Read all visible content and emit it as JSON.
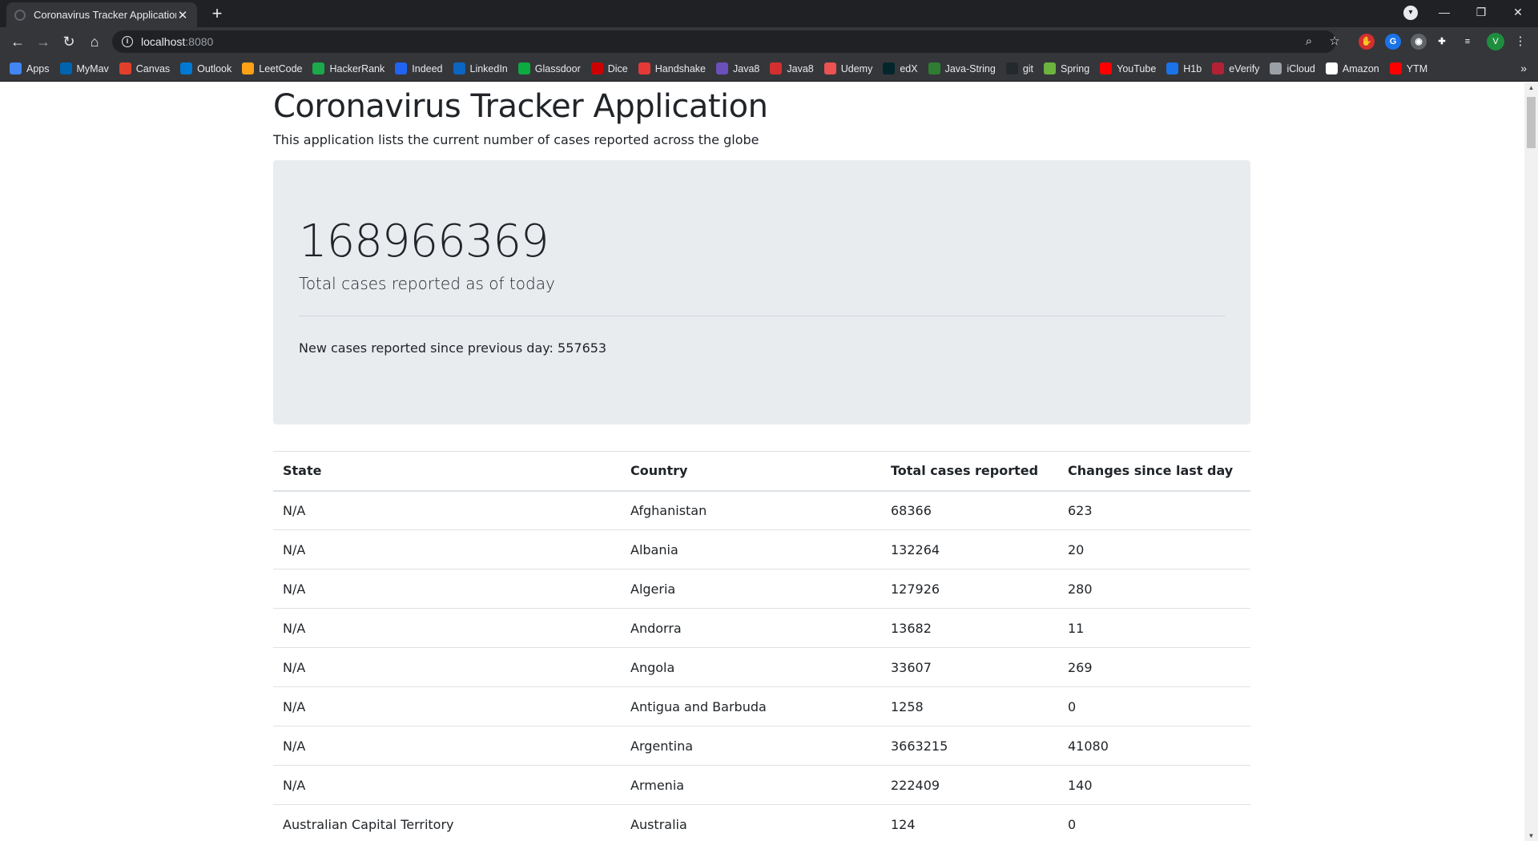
{
  "browser": {
    "tab_title": "Coronavirus Tracker Application",
    "url_host": "localhost",
    "url_port": ":8080",
    "profile_initial": "V",
    "bookmarks": [
      {
        "label": "Apps",
        "icon": "apps-grid-icon",
        "color": "#4285f4"
      },
      {
        "label": "MyMav",
        "icon": "mymav-icon",
        "color": "#0064b1"
      },
      {
        "label": "Canvas",
        "icon": "canvas-icon",
        "color": "#e13f2b"
      },
      {
        "label": "Outlook",
        "icon": "outlook-icon",
        "color": "#0078d4"
      },
      {
        "label": "LeetCode",
        "icon": "leetcode-icon",
        "color": "#ffa116"
      },
      {
        "label": "HackerRank",
        "icon": "hackerrank-icon",
        "color": "#1ba94c"
      },
      {
        "label": "Indeed",
        "icon": "indeed-icon",
        "color": "#2164f3"
      },
      {
        "label": "LinkedIn",
        "icon": "linkedin-icon",
        "color": "#0a66c2"
      },
      {
        "label": "Glassdoor",
        "icon": "glassdoor-icon",
        "color": "#0caa41"
      },
      {
        "label": "Dice",
        "icon": "dice-icon",
        "color": "#cc0000"
      },
      {
        "label": "Handshake",
        "icon": "handshake-icon",
        "color": "#e53935"
      },
      {
        "label": "Java8",
        "icon": "java8-icon",
        "color": "#6b4fbb"
      },
      {
        "label": "Java8",
        "icon": "java8-v-icon",
        "color": "#d32f2f"
      },
      {
        "label": "Udemy",
        "icon": "udemy-icon",
        "color": "#ec5252"
      },
      {
        "label": "edX",
        "icon": "edx-icon",
        "color": "#02262b"
      },
      {
        "label": "Java-String",
        "icon": "java-string-icon",
        "color": "#2e7d32"
      },
      {
        "label": "git",
        "icon": "github-icon",
        "color": "#24292e"
      },
      {
        "label": "Spring",
        "icon": "spring-icon",
        "color": "#6db33f"
      },
      {
        "label": "YouTube",
        "icon": "youtube-icon",
        "color": "#ff0000"
      },
      {
        "label": "H1b",
        "icon": "h1b-icon",
        "color": "#1a73e8"
      },
      {
        "label": "eVerify",
        "icon": "everify-icon",
        "color": "#b22234"
      },
      {
        "label": "iCloud",
        "icon": "apple-icon",
        "color": "#9aa0a6"
      },
      {
        "label": "Amazon",
        "icon": "amazon-icon",
        "color": "#ffffff"
      },
      {
        "label": "YTM",
        "icon": "youtube-music-icon",
        "color": "#ff0000"
      }
    ]
  },
  "page": {
    "title": "Coronavirus Tracker Application",
    "subtitle": "This application lists the current number of cases reported across the globe",
    "total_cases": "168966369",
    "total_cases_label": "Total cases reported as of today",
    "new_cases_text": "New cases reported since previous day: 557653"
  },
  "table": {
    "headers": [
      "State",
      "Country",
      "Total cases reported",
      "Changes since last day"
    ],
    "rows": [
      [
        "N/A",
        "Afghanistan",
        "68366",
        "623"
      ],
      [
        "N/A",
        "Albania",
        "132264",
        "20"
      ],
      [
        "N/A",
        "Algeria",
        "127926",
        "280"
      ],
      [
        "N/A",
        "Andorra",
        "13682",
        "11"
      ],
      [
        "N/A",
        "Angola",
        "33607",
        "269"
      ],
      [
        "N/A",
        "Antigua and Barbuda",
        "1258",
        "0"
      ],
      [
        "N/A",
        "Argentina",
        "3663215",
        "41080"
      ],
      [
        "N/A",
        "Armenia",
        "222409",
        "140"
      ],
      [
        "Australian Capital Territory",
        "Australia",
        "124",
        "0"
      ]
    ]
  }
}
